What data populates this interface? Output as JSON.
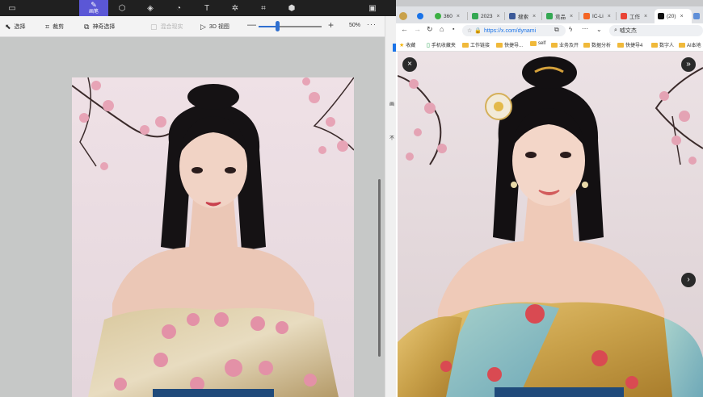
{
  "paint": {
    "active_tool_label": "画笔",
    "top_icons": [
      "file-icon",
      "brush-icon",
      "shapes-icon",
      "cube-icon",
      "sticker-icon",
      "text-icon",
      "effects-icon",
      "crop-icon",
      "3d-library-icon",
      "paste-icon"
    ],
    "toolbar": {
      "select_label": "选择",
      "crop_label": "裁剪",
      "magic_select_label": "神奇选择",
      "mix_label": "混合现实",
      "view3d_label": "3D 视图",
      "zoom_text": "50%",
      "more_label": "···",
      "minus_label": "—",
      "plus_label": "+"
    },
    "zoom_value": 50
  },
  "browser": {
    "tabs": [
      {
        "label": "",
        "color": "#c9a14a"
      },
      {
        "label": "",
        "color": "#1a73e8"
      },
      {
        "label": "360",
        "color": "#3cb043"
      },
      {
        "label": "2023",
        "color": "#34a853"
      },
      {
        "label": "搜索",
        "color": "#3b5998"
      },
      {
        "label": "竞品",
        "color": "#34a853"
      },
      {
        "label": "IC-Li",
        "color": "#f46524"
      },
      {
        "label": "工作",
        "color": "#e94335"
      },
      {
        "label": "(20)",
        "color": "#111111"
      }
    ],
    "close_glyph": "×",
    "new_tab_glyph": "+",
    "url": "https://x.com/dynami",
    "search_text": "嘘文杰",
    "bookmarks": [
      "收藏",
      "手机收藏夹",
      "工作链接",
      "快捷导...",
      "self",
      "业务及开",
      "数据分析",
      "快捷导4",
      "数字人",
      "AI本地"
    ]
  },
  "viewer": {
    "close_glyph": "×",
    "expand_glyph": "»",
    "next_glyph": "›"
  }
}
